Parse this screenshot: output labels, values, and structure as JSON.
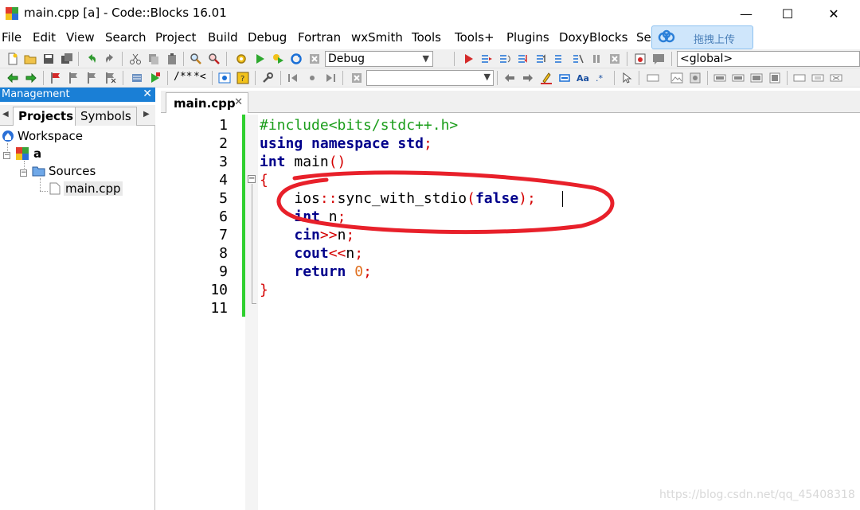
{
  "window": {
    "title": "main.cpp [a] - Code::Blocks 16.01",
    "controls": {
      "minimize": "—",
      "maximize": "☐",
      "close": "✕"
    }
  },
  "menu": {
    "items": [
      "File",
      "Edit",
      "View",
      "Search",
      "Project",
      "Build",
      "Debug",
      "Fortran",
      "wxSmith",
      "Tools",
      "Tools+",
      "Plugins",
      "DoxyBlocks",
      "Se"
    ]
  },
  "upload_widget": {
    "label": "拖拽上传"
  },
  "toolbar": {
    "build_target": "Debug",
    "scope": "<global>",
    "doxy_comment": "/**",
    "doxy_line": "*<"
  },
  "management": {
    "title": "Management",
    "tabs": [
      "Projects",
      "Symbols"
    ],
    "active_tab": "Projects",
    "tree": {
      "workspace": "Workspace",
      "project": "a",
      "folder": "Sources",
      "file": "main.cpp"
    }
  },
  "editor": {
    "tab_label": "main.cpp",
    "line_numbers": [
      "1",
      "2",
      "3",
      "4",
      "5",
      "6",
      "7",
      "8",
      "9",
      "10",
      "11"
    ],
    "code": {
      "l1": "#include<bits/stdc++.h>",
      "l2_kw1": "using",
      "l2_kw2": "namespace",
      "l2_std": "std",
      "l2_semi": ";",
      "l3_kw": "int",
      "l3_name": "main",
      "l3_paren": "()",
      "l4": "{",
      "l5_ios": "ios",
      "l5_scope": "::",
      "l5_fn": "sync_with_stdio",
      "l5_open": "(",
      "l5_false": "false",
      "l5_close": ");",
      "l6_kw": "int",
      "l6_var": "n",
      "l6_semi": ";",
      "l7_cin": "cin",
      "l7_op": ">>",
      "l7_var": "n",
      "l7_semi": ";",
      "l8_cout": "cout",
      "l8_op": "<<",
      "l8_var": "n",
      "l8_semi": ";",
      "l9_kw": "return",
      "l9_num": "0",
      "l9_semi": ";",
      "l10": "}"
    }
  },
  "watermark": "https://blog.csdn.net/qq_45408318",
  "colors": {
    "keyword": "#00008b",
    "preprocessor": "#1a9d1a",
    "operator": "#d40000",
    "number": "#e07020",
    "changed_line_marker": "#2fd02f",
    "annotation": "#e8202a",
    "management_header": "#1a7fd6"
  }
}
